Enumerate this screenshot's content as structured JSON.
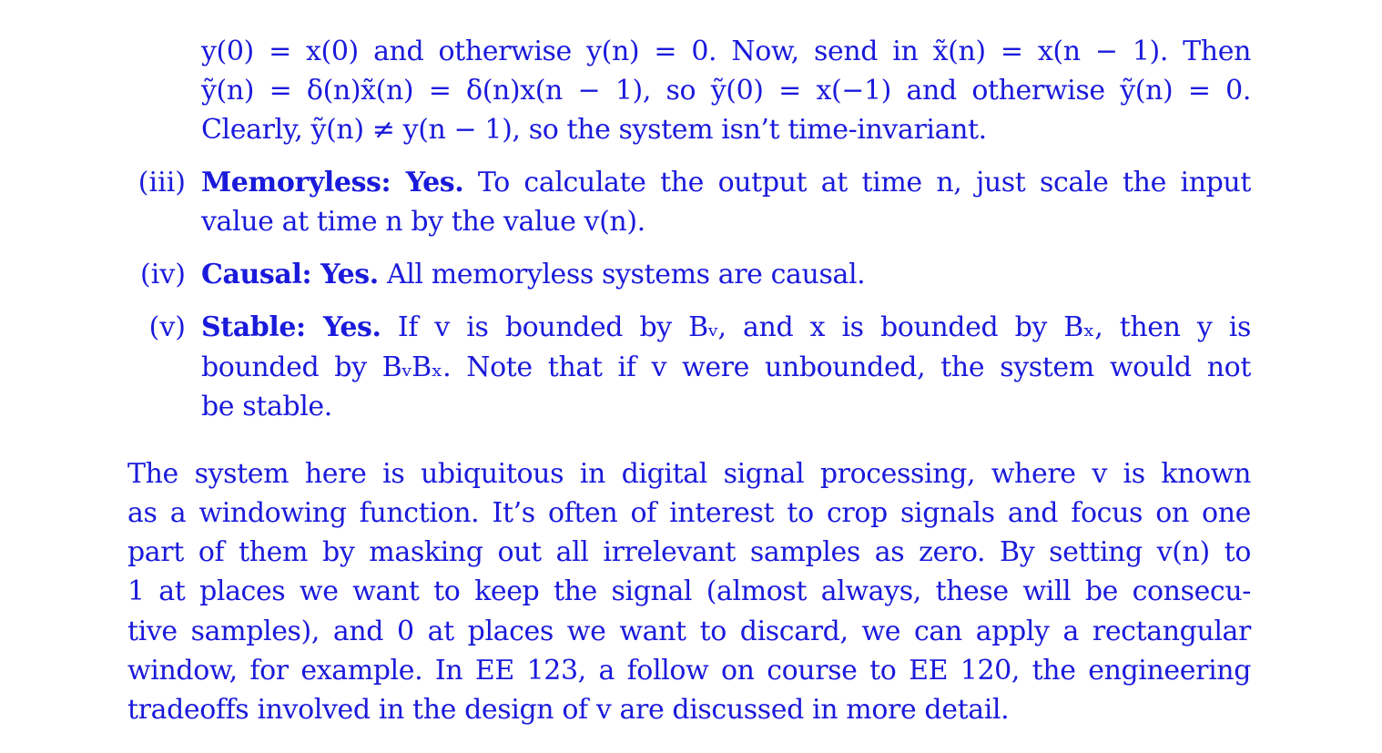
{
  "continuation": {
    "lines": [
      "y(0) = x(0) and otherwise y(n) = 0. Now, send in x̃(n) = x(n − 1). Then",
      "ỹ(n) = δ(n)x̃(n) = δ(n)x(n − 1), so ỹ(0) = x(−1) and otherwise ỹ(n) = 0.",
      "Clearly, ỹ(n) ≠ y(n − 1), so the system isn’t time-invariant."
    ]
  },
  "items": [
    {
      "label": "(iii)",
      "heading": "Memoryless: Yes.",
      "lines": [
        " To calculate the output at time n, just scale the input",
        "value at time n by the value v(n)."
      ]
    },
    {
      "label": "(iv)",
      "heading": "Causal: Yes.",
      "lines": [
        " All memoryless systems are causal."
      ]
    },
    {
      "label": "(v)",
      "heading": "Stable: Yes.",
      "lines": [
        "  If v is bounded by Bᵥ, and x is bounded by Bₓ, then y is",
        "bounded by BᵥBₓ. Note that if v were unbounded, the system would not",
        "be stable."
      ]
    }
  ],
  "paragraph": {
    "lines": [
      "The system here is ubiquitous in digital signal processing, where v is known",
      "as a windowing function. It’s often of interest to crop signals and focus on one",
      "part of them by masking out all irrelevant samples as zero. By setting v(n) to",
      "1 at places we want to keep the signal (almost always, these will be consecu-",
      "tive samples), and 0 at places we want to discard, we can apply a rectangular",
      "window, for example. In EE 123, a follow on course to EE 120, the engineering",
      "tradeoffs involved in the design of v are discussed in more detail."
    ]
  }
}
